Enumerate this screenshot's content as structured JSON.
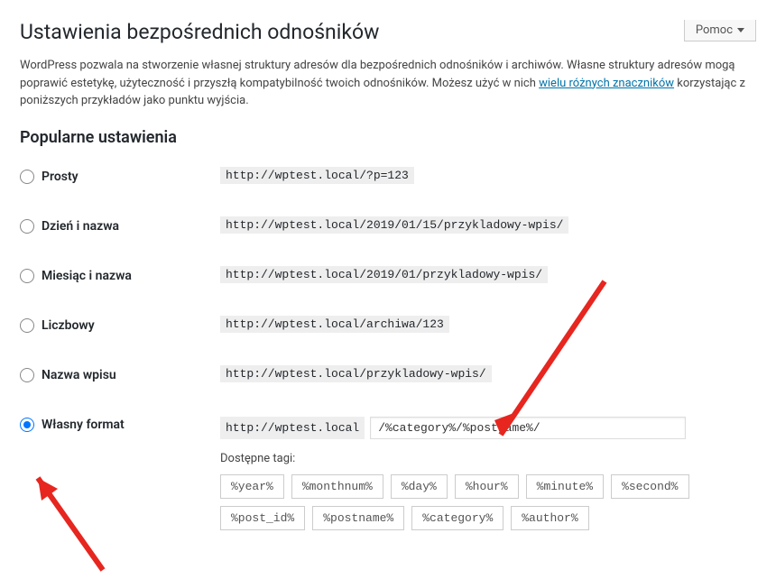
{
  "help": {
    "label": "Pomoc"
  },
  "title": "Ustawienia bezpośrednich odnośników",
  "description": {
    "part1": "WordPress pozwala na stworzenie własnej struktury adresów dla bezpośrednich odnośników i archiwów. Własne struktury adresów mogą poprawić estetykę, użyteczność i przyszłą kompatybilność twoich odnośników. Możesz użyć w nich ",
    "link": "wielu różnych znaczników",
    "part2": " korzystając z poniższych przykładów jako punktu wyjścia."
  },
  "section_heading": "Popularne ustawienia",
  "options": [
    {
      "label": "Prosty",
      "example": "http://wptest.local/?p=123",
      "checked": false
    },
    {
      "label": "Dzień i nazwa",
      "example": "http://wptest.local/2019/01/15/przykladowy-wpis/",
      "checked": false
    },
    {
      "label": "Miesiąc i nazwa",
      "example": "http://wptest.local/2019/01/przykladowy-wpis/",
      "checked": false
    },
    {
      "label": "Liczbowy",
      "example": "http://wptest.local/archiwa/123",
      "checked": false
    },
    {
      "label": "Nazwa wpisu",
      "example": "http://wptest.local/przykladowy-wpis/",
      "checked": false
    }
  ],
  "custom": {
    "label": "Własny format",
    "checked": true,
    "prefix": "http://wptest.local",
    "value": "/%category%/%postname%/",
    "tags_label": "Dostępne tagi:",
    "tags": [
      "%year%",
      "%monthnum%",
      "%day%",
      "%hour%",
      "%minute%",
      "%second%",
      "%post_id%",
      "%postname%",
      "%category%",
      "%author%"
    ]
  }
}
